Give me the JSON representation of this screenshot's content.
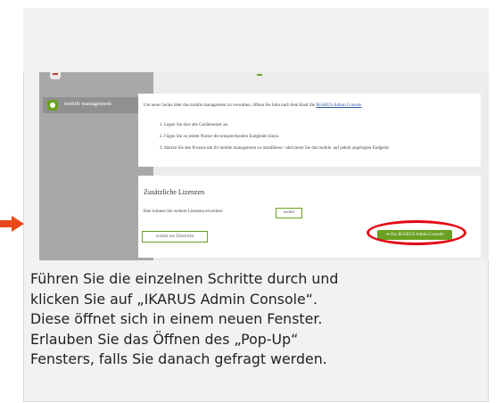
{
  "sidebar": {
    "previous_item_label": "",
    "active_item": {
      "label": "mobile management",
      "icon": "mobile-device-icon"
    }
  },
  "panel_main": {
    "intro_text": "Um neue Geräte über das mobile management zu verwalten, öffnen Sie bitte nach dem Kauf die",
    "intro_link": "IKARUS Admin Console",
    "steps": [
      "1.  Legen Sie dort alle Gerätenutzer an.",
      "2.  Fügen Sie zu jedem Nutzer die entsprechenden Endgeräte hinzu.",
      "3.  Starten Sie den Prozess um ihr mobile management zu installieren / aktivieren Sie das mobile. auf jedem angelegten Endgerät."
    ]
  },
  "panel_licenses": {
    "title": "Zusätzliche Lizenzen",
    "text": "Hier können Sie weitere Lizenzen erwerben:",
    "weiter_label": "weiter",
    "back_label": "zurück zur Übersicht",
    "console_label": "➔ Zur IKARUS Admin Console"
  },
  "caption_lines": [
    "Führen Sie die einzelnen Schritte durch und",
    "klicken Sie auf „IKARUS Admin Console“.",
    "Diese öffnet sich in einem neuen Fenster.",
    "Erlauben Sie das Öffnen des „Pop-Up“",
    "Fensters, falls Sie danach gefragt werden."
  ],
  "colors": {
    "brand_green": "#6aa121",
    "highlight_red": "#e30613",
    "arrow_orange": "#e8481b",
    "sidebar_gray": "#a8a8a8"
  }
}
